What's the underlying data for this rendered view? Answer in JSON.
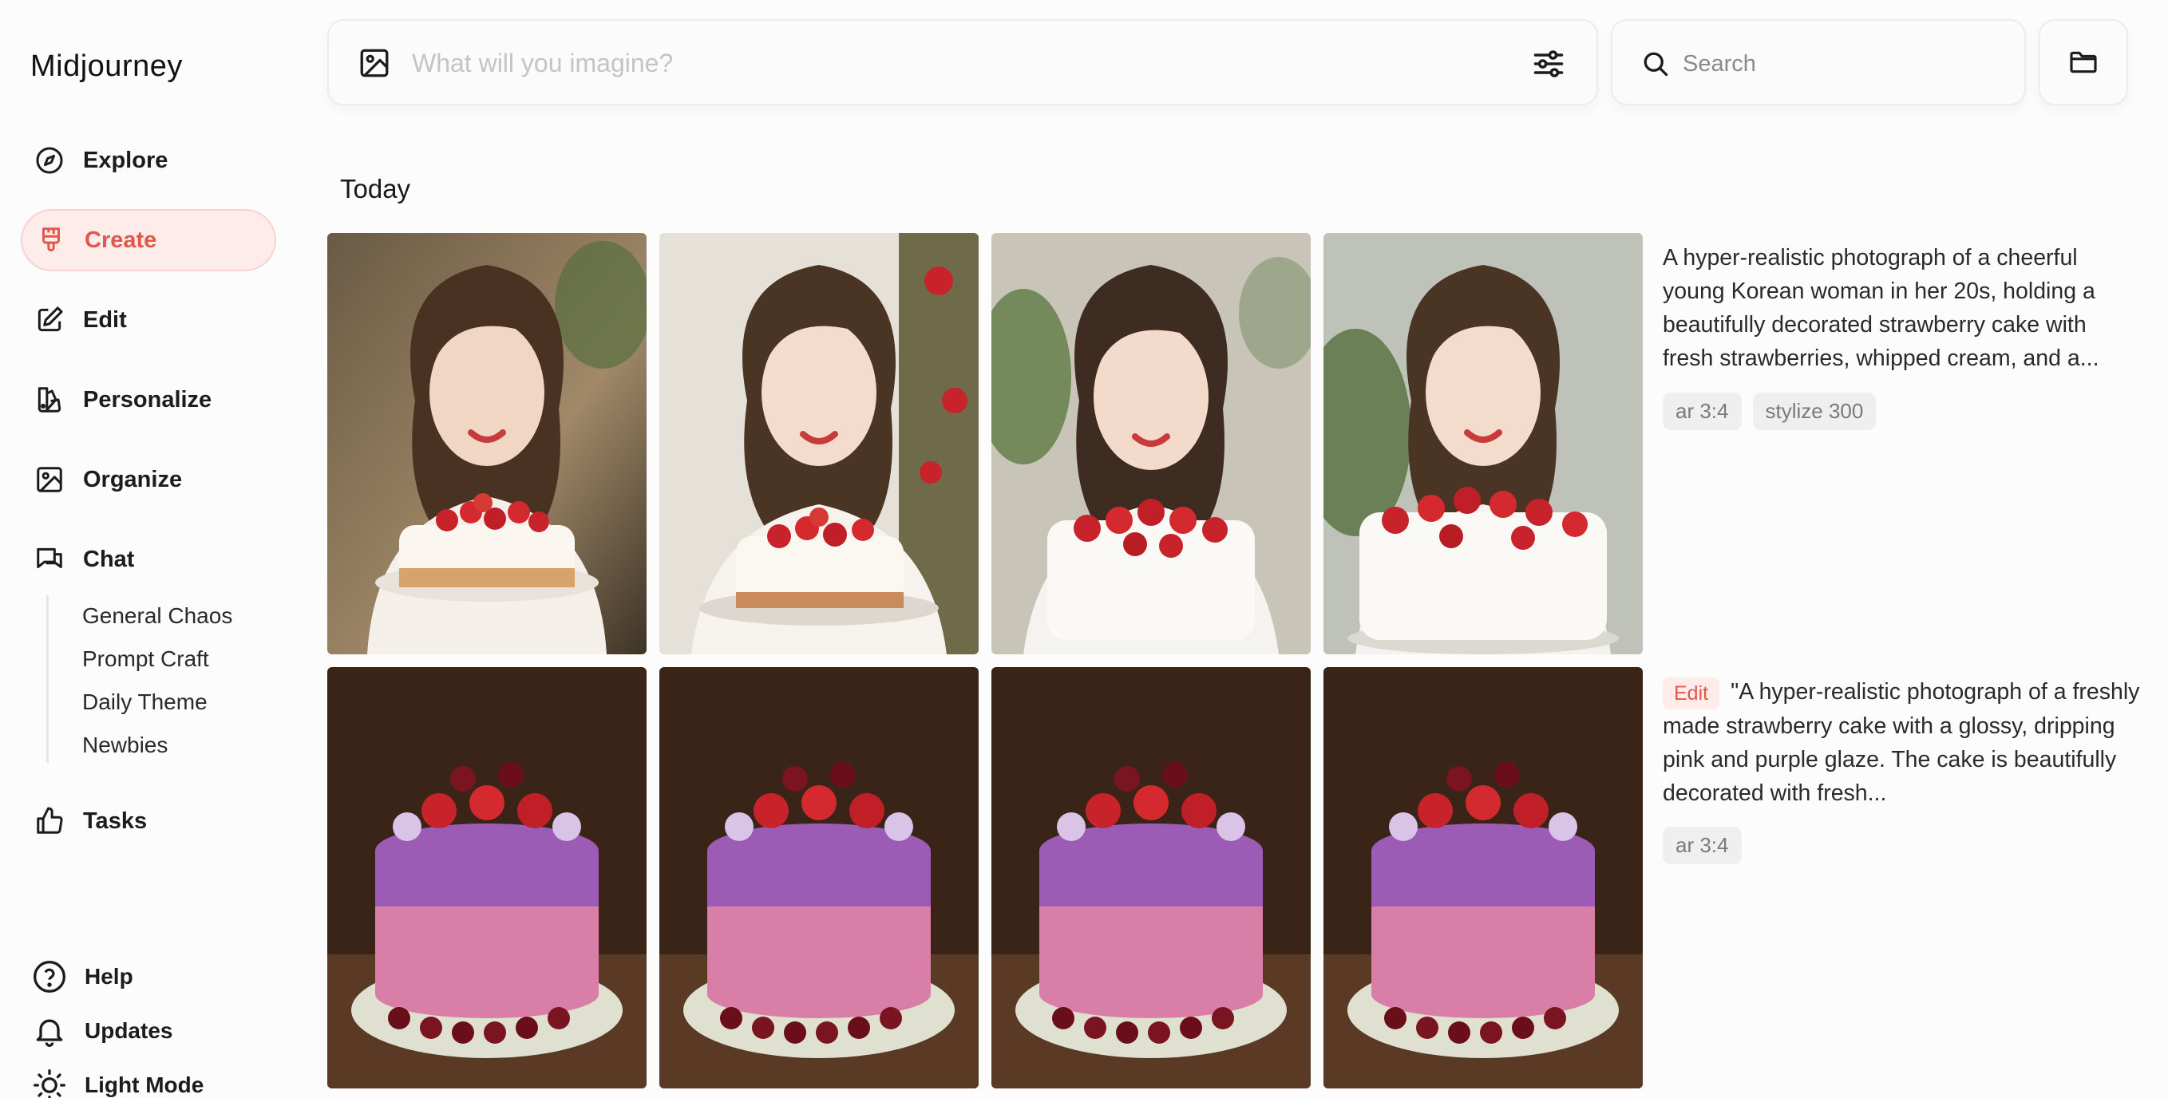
{
  "app": {
    "brand": "Midjourney"
  },
  "sidebar": {
    "nav": [
      {
        "label": "Explore",
        "icon": "compass-icon",
        "active": false
      },
      {
        "label": "Create",
        "icon": "brush-icon",
        "active": true
      },
      {
        "label": "Edit",
        "icon": "edit-icon",
        "active": false
      },
      {
        "label": "Personalize",
        "icon": "palette-icon",
        "active": false
      },
      {
        "label": "Organize",
        "icon": "image-icon",
        "active": false
      },
      {
        "label": "Chat",
        "icon": "chat-icon",
        "active": false
      }
    ],
    "chat_rooms": [
      "General Chaos",
      "Prompt Craft",
      "Daily Theme",
      "Newbies"
    ],
    "tasks": {
      "label": "Tasks",
      "icon": "thumbs-up-icon"
    },
    "footer": [
      {
        "label": "Help",
        "icon": "help-icon"
      },
      {
        "label": "Updates",
        "icon": "bell-icon"
      },
      {
        "label": "Light Mode",
        "icon": "sun-icon"
      }
    ]
  },
  "topbar": {
    "prompt_placeholder": "What will you imagine?",
    "search_placeholder": "Search"
  },
  "feed": {
    "section_title": "Today",
    "jobs": [
      {
        "prompt": "A hyper-realistic photograph of a cheerful young Korean woman in her 20s, holding a beautifully decorated strawberry cake with fresh strawberries, whipped cream, and a...",
        "badge": "",
        "tags": [
          "ar 3:4",
          "stylize 300"
        ],
        "subject": "woman-with-strawberry-cake"
      },
      {
        "prompt": "\"A hyper-realistic photograph of a freshly made strawberry cake with a glossy, dripping pink and purple glaze. The cake is beautifully decorated with fresh...",
        "badge": "Edit",
        "tags": [
          "ar 3:4"
        ],
        "subject": "pink-purple-glazed-strawberry-cake"
      }
    ]
  },
  "colors": {
    "accent": "#e2574c",
    "accent_bg": "#fdecea",
    "tag_bg": "#efefef",
    "border": "#ececec"
  }
}
